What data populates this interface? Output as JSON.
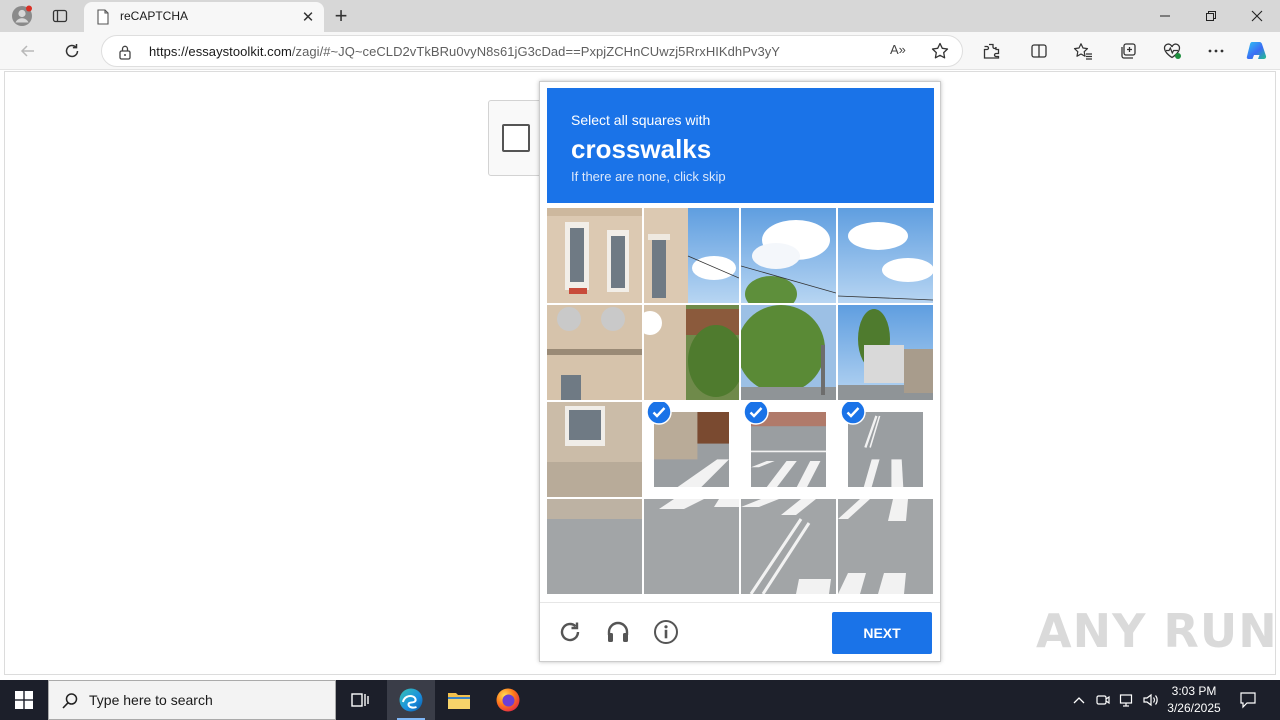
{
  "browser": {
    "tab_title": "reCAPTCHA",
    "url_host": "https://essaystoolkit.com",
    "url_path": "/zagi/#~JQ~ceCLD2vTkBRu0vyN8s61jG3cDad==PxpjZCHnCUwzj5RrxHIKdhPv3yY",
    "read_aloud_label": "A»"
  },
  "captcha": {
    "line1": "Select all squares with",
    "keyword": "crosswalks",
    "line3": "If there are none, click skip",
    "next_label": "NEXT",
    "grid_rows": 4,
    "grid_cols": 4,
    "selected_tiles": [
      {
        "row": 3,
        "col": 2
      },
      {
        "row": 3,
        "col": 3
      },
      {
        "row": 3,
        "col": 4
      }
    ],
    "accent_color": "#1a73e8"
  },
  "watermark": "ANY RUN",
  "taskbar": {
    "search_placeholder": "Type here to search",
    "time": "3:03 PM",
    "date": "3/26/2025"
  }
}
